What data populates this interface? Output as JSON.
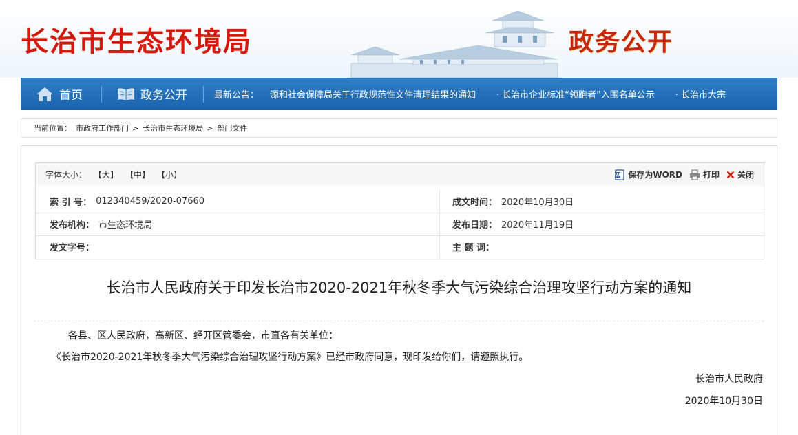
{
  "header": {
    "site_name": "长治市生态环境局",
    "slogan": "政务公开"
  },
  "nav": {
    "home_label": "首页",
    "gov_label": "政务公开",
    "notice_label": "最新公告：",
    "ticker_items": [
      "源和社会保障局关于行政规范性文件清理结果的通知",
      "· 长治市企业标准“领跑者”入围名单公示",
      "· 长治市大宗"
    ]
  },
  "breadcrumb": {
    "label": "当前位置：",
    "items": [
      "市政府工作部门",
      "长治市生态环境局",
      "部门文件"
    ],
    "separator": ">"
  },
  "toolbar": {
    "font_size_label": "字体大小：",
    "large": "【大】",
    "medium": "【中】",
    "small": "【小】",
    "save_word": "保存为WORD",
    "print": "打印",
    "close": "关闭"
  },
  "meta": {
    "index_label": "索 引 号：",
    "index_value": "012340459/2020-07660",
    "created_label": "成文时间：",
    "created_value": "2020年10月30日",
    "publisher_label": "发布机构：",
    "publisher_value": "市生态环境局",
    "published_label": "发布日期：",
    "published_value": "2020年11月19日",
    "doc_no_label": "发文字号：",
    "doc_no_value": "",
    "subject_label": "主 题 词：",
    "subject_value": ""
  },
  "article": {
    "title": "长治市人民政府关于印发长治市2020-2021年秋冬季大气污染综合治理攻坚行动方案的通知",
    "salutation": "各县、区人民政府，高新区、经开区管委会，市直各有关单位：",
    "body": "《长治市2020-2021年秋冬季大气污染综合治理攻坚行动方案》已经市政府同意，现印发给你们，请遵照执行。",
    "signer": "长治市人民政府",
    "date": "2020年10月30日"
  },
  "colors": {
    "brand_red": "#d4190f",
    "nav_blue": "#1a63ad"
  }
}
